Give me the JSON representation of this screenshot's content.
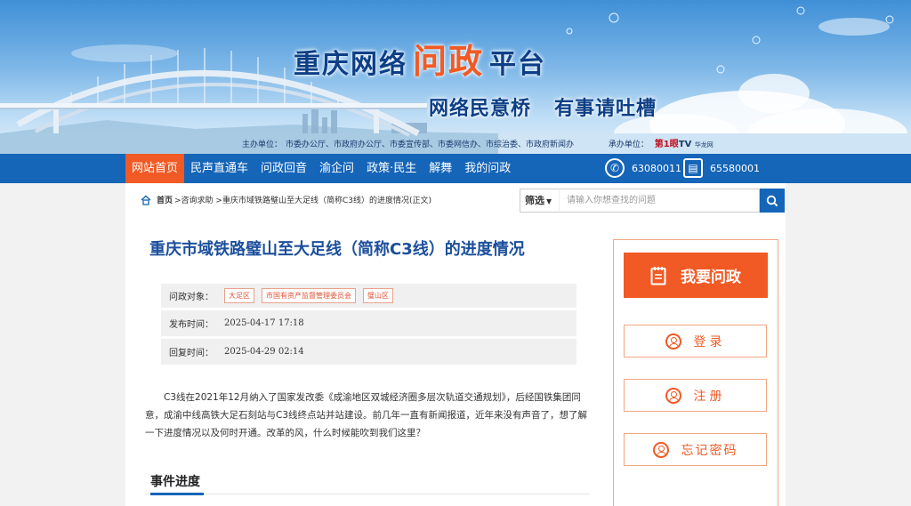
{
  "header": {
    "title_part1": "重庆网络",
    "title_highlight": "问政",
    "title_part2": "平台",
    "slogan_1": "网络民意桥",
    "slogan_2": "有事请吐槽",
    "sponsor_label": "主办单位：",
    "sponsor_orgs": "市委办公厅、市政府办公厅、市委宣传部、市委网信办、市综治委、市政府新闻办",
    "co_label": "承办单位：",
    "co_logo_1": "第1眼",
    "co_logo_2": "TV",
    "co_logo_3": "华龙网"
  },
  "nav": {
    "items": [
      "网站首页",
      "民声直通车",
      "问政回音",
      "渝企问",
      "政策·民生",
      "解舞",
      "我的问政"
    ],
    "phone_1": "63080011",
    "phone_2": "65580001"
  },
  "breadcrumb": {
    "home": "首页",
    "path": ">咨询求助 >重庆市域铁路璧山至大足线（简称C3线）的进度情况(正文)"
  },
  "search": {
    "filter_label": "筛选",
    "placeholder": "请输入你想查找的问题"
  },
  "article": {
    "title": "重庆市域铁路璧山至大足线（简称C3线）的进度情况",
    "target_label": "问政对象：",
    "targets": [
      "大足区",
      "市国有资产监督管理委员会",
      "璧山区"
    ],
    "publish_label": "发布时间：",
    "publish_time": "2025-04-17 17:18",
    "reply_label": "回复时间：",
    "reply_time": "2025-04-29 02:14",
    "body": "C3线在2021年12月纳入了国家发改委《成渝地区双城经济圈多层次轨道交通规划》，后经国铁集团同意，成渝中线高铁大足石刻站与C3线终点站并站建设。前几年一直有新闻报道，近年来没有声音了，想了解一下进度情况以及何时开通。改革的风，什么时候能吹到我们这里？",
    "section_title": "事件进度"
  },
  "sidebar": {
    "ask_label": "我要问政",
    "login_label": "登录",
    "register_label": "注册",
    "forgot_label": "忘记密码"
  },
  "colors": {
    "brand_blue": "#1565b8",
    "accent_orange": "#f15a24",
    "title_blue": "#1c4f9c"
  }
}
